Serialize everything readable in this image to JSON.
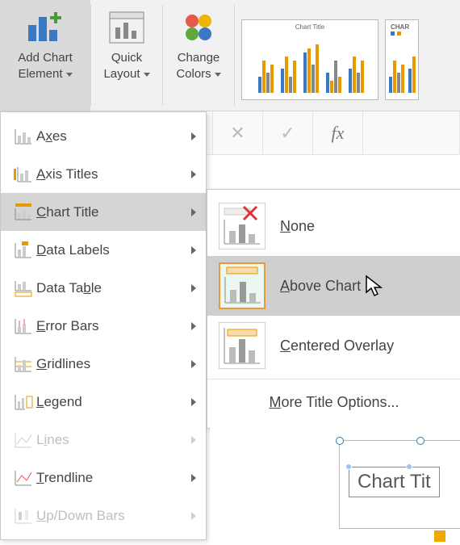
{
  "ribbon": {
    "addChart": {
      "line1": "Add Chart",
      "line2": "Element"
    },
    "quickLayout": {
      "line1": "Quick",
      "line2": "Layout"
    },
    "changeColors": {
      "line1": "Change",
      "line2": "Colors"
    },
    "thumb1_title": "Chart Title",
    "thumb2_title": "CHAR"
  },
  "formula": {
    "x": "✕",
    "check": "✓",
    "fx": "fx"
  },
  "menu": {
    "axes": {
      "u": "x",
      "pre": "A",
      "post": "es"
    },
    "axisTitles": {
      "u": "A",
      "post": "xis Titles"
    },
    "chartTitle": {
      "u": "C",
      "post": "hart Title"
    },
    "dataLabels": {
      "u": "D",
      "post": "ata Labels"
    },
    "dataTable": {
      "u": "b",
      "pre": "Data Ta",
      "post": "le"
    },
    "errorBars": {
      "u": "E",
      "post": "rror Bars"
    },
    "gridlines": {
      "u": "G",
      "post": "ridlines"
    },
    "legend": {
      "u": "L",
      "post": "egend"
    },
    "lines": {
      "u": "i",
      "pre": "L",
      "post": "nes"
    },
    "trendline": {
      "u": "T",
      "post": "rendline"
    },
    "updown": {
      "u": "U",
      "post": "p/Down Bars"
    }
  },
  "sub": {
    "none": {
      "u": "N",
      "post": "one"
    },
    "above": {
      "u": "A",
      "post": "bove Chart"
    },
    "centered": {
      "u": "C",
      "post": "entered Overlay"
    },
    "more": {
      "u": "M",
      "post": "ore Title Options..."
    }
  },
  "chart": {
    "title": "Chart Tit"
  }
}
